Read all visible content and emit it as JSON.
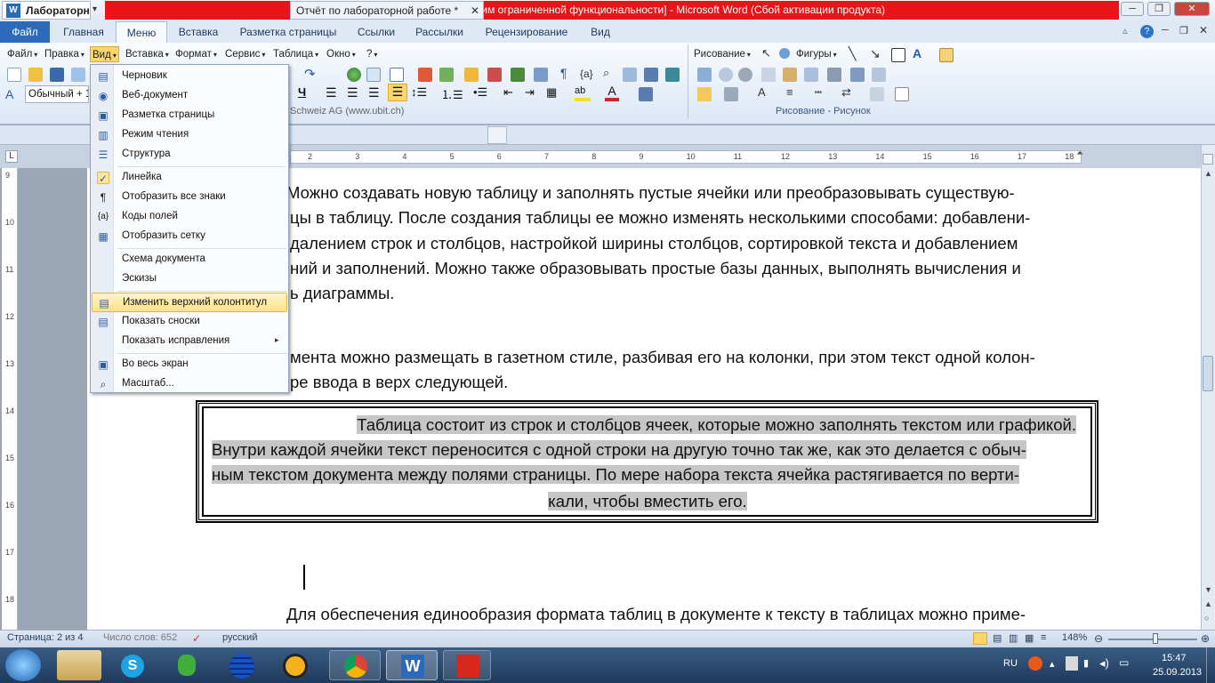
{
  "window": {
    "title": "Лабораторная работа 1 [Режим ограниченной функциональности]  -  Microsoft Word (Сбой активации продукта)",
    "buttons": [
      "─",
      "❐",
      "✕"
    ]
  },
  "ribbon_tabs": [
    "Файл",
    "Главная",
    "Меню",
    "Вставка",
    "Разметка страницы",
    "Ссылки",
    "Рассылки",
    "Рецензирование",
    "Вид"
  ],
  "classic_menu": [
    "Файл",
    "Правка",
    "Вид",
    "Вставка",
    "Формат",
    "Сервис",
    "Таблица",
    "Окно",
    "?"
  ],
  "style_box": "Обычный + 1",
  "watermark_text": "Schweiz AG   (www.ubit.ch)",
  "drawing": {
    "menu_label": "Рисование",
    "shapes_label": "Фигуры",
    "group_label": "Рисование - Рисунок"
  },
  "doc_tabs": [
    "Лабораторн",
    "Отчёт по лабораторной работе  *"
  ],
  "ruler_numbers": [
    "2",
    "3",
    "4",
    "5",
    "6",
    "7",
    "8",
    "9",
    "10",
    "11",
    "12",
    "13",
    "14",
    "15",
    "16",
    "17",
    "18"
  ],
  "vruler_numbers": [
    "9",
    "10",
    "11",
    "12",
    "13",
    "14",
    "15",
    "16",
    "17",
    "18"
  ],
  "view_menu": [
    {
      "label": "Черновик",
      "icon": "draft-icon"
    },
    {
      "label": "Веб-документ",
      "icon": "web-icon"
    },
    {
      "label": "Разметка страницы",
      "icon": "page-layout-icon"
    },
    {
      "label": "Режим чтения",
      "icon": "reading-icon"
    },
    {
      "label": "Структура",
      "icon": "outline-icon"
    },
    {
      "label": "Линейка",
      "icon": "check-icon"
    },
    {
      "label": "Отобразить все знаки",
      "icon": "pilcrow-icon"
    },
    {
      "label": "Коды полей",
      "icon": "field-codes-icon"
    },
    {
      "label": "Отобразить сетку",
      "icon": "grid-icon"
    },
    {
      "label": "Схема документа",
      "icon": ""
    },
    {
      "label": "Эскизы",
      "icon": ""
    },
    {
      "label": "Изменить верхний колонтитул",
      "icon": "header-icon"
    },
    {
      "label": "Показать сноски",
      "icon": "footnote-icon"
    },
    {
      "label": "Показать исправления",
      "icon": ""
    },
    {
      "label": "Во весь экран",
      "icon": "fullscreen-icon"
    },
    {
      "label": "Масштаб...",
      "icon": "zoom-icon"
    }
  ],
  "document": {
    "para1": [
      "Можно создавать новую таблицу и заполнять пустые ячейки или преобразовывать существую-",
      "цы в таблицу. После создания таблицы ее можно изменять несколькими способами: добавлени-",
      "далением строк и столбцов, настройкой ширины столбцов, сортировкой текста и добавлением",
      "ний и заполнений. Можно также образовывать простые базы данных, выполнять вычисления и",
      "ь диаграммы."
    ],
    "para2": [
      "мента можно размещать в газетном стиле, разбивая его на колонки, при этом текст одной колон-",
      "ре ввода в верх следующей."
    ],
    "table_text": [
      "Таблица состоит из строк и столбцов ячеек, которые можно заполнять текстом или графикой.",
      "Внутри каждой ячейки текст переносится с одной строки на другую точно так же, как это делается с обыч-",
      "ным текстом документа между полями страницы. По мере набора текста ячейка растягивается по верти-",
      "кали, чтобы вместить его."
    ],
    "para3": "Для обеспечения единообразия формата таблиц в документе к тексту в таблицах можно приме-"
  },
  "status": {
    "page": "Страница: 2 из 4",
    "words": "Число слов: 652",
    "language": "русский",
    "zoom": "148%"
  },
  "tray": {
    "lang": "RU",
    "time": "15:47",
    "date": "25.09.2013"
  },
  "colors": {
    "title_red": "#e8141a",
    "file_tab": "#2a6ab8",
    "highlight": "#c6c6c6"
  }
}
